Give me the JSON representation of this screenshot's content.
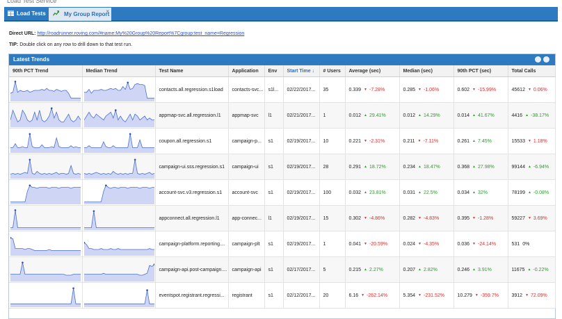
{
  "tabs": [
    {
      "label": "Load Tests"
    },
    {
      "label": "My Group Report",
      "close": "×"
    }
  ],
  "direct_url": {
    "label": "Direct URL:",
    "url": "http://roadrunner.roving.com/#name:My%20Group%20Report%7Cgroup:test_name=Regression"
  },
  "tip": {
    "label": "TIP:",
    "text": "Double click on any row to drill down to that test run."
  },
  "panel": {
    "title": "Latest Trends",
    "icons": [
      "print-icon",
      "refresh-icon"
    ]
  },
  "columns": [
    "90th PCT Trend",
    "Median Trend",
    "Test Name",
    "Application",
    "Env",
    "Start Time ↓",
    "# Users",
    "Average (sec)",
    "Median (sec)",
    "90th PCT (sec)",
    "Total Calls"
  ],
  "rows": [
    {
      "test": "contacts.all.regression.s1load",
      "app": "contacts-svc...",
      "env": "s1l...",
      "start": "02/22/2017...",
      "users": "35",
      "avg": "0.339",
      "avg_pct": "-7.28%",
      "avg_dir": "neg",
      "med": "0.285",
      "med_pct": "-1.06%",
      "med_dir": "neg",
      "p90": "0.602",
      "p90_pct": "-15.99%",
      "p90_dir": "neg",
      "calls": "45612",
      "calls_pct": "0.06%",
      "calls_dir": "neg",
      "spark1": [
        0.35,
        0.4,
        0.95,
        0.4,
        0.5,
        0.45,
        0.45,
        0.5,
        0.4,
        0.45,
        0.5,
        0.5,
        0.5,
        0.55,
        0.5,
        0.6,
        0.5,
        0.5,
        0.45,
        0.55,
        0.5,
        0.45,
        0.5,
        0.5,
        0.35,
        0.1,
        0.1,
        0.1,
        0.1,
        0.1
      ],
      "spark2": [
        0.4,
        0.4,
        0.55,
        0.35,
        0.5,
        0.5,
        0.5,
        0.55,
        0.5,
        0.5,
        0.55,
        0.6,
        0.55,
        0.6,
        0.5,
        0.5,
        0.7,
        0.55,
        0.9,
        0.55,
        0.6,
        0.8,
        0.85,
        0.8,
        0.8,
        0.75,
        0.1,
        0.1,
        0.1,
        0.1
      ]
    },
    {
      "test": "appmap-svc.all.regression.l1",
      "app": "appmap-svc",
      "env": "l1",
      "start": "02/21/2017...",
      "users": "1",
      "avg": "0.012",
      "avg_pct": "29.41%",
      "avg_dir": "pos",
      "med": "0.012",
      "med_pct": "14.29%",
      "med_dir": "pos",
      "p90": "0.014",
      "p90_pct": "41.67%",
      "p90_dir": "pos",
      "calls": "4416",
      "calls_pct": "-38.17%",
      "calls_dir": "pos",
      "spark1": [
        0.3,
        0.8,
        0.5,
        0.2,
        0.3,
        0.8,
        0.6,
        0.3,
        0.2,
        0.3,
        0.7,
        0.3,
        0.8,
        0.3,
        0.2,
        0.3,
        0.5,
        0.9,
        0.4,
        0.7,
        0.3,
        0.2,
        0.2,
        0.4,
        0.6,
        0.3,
        0.2,
        0.3,
        0.5,
        0.3
      ],
      "spark2": [
        0.3,
        0.5,
        0.7,
        0.5,
        0.4,
        0.6,
        0.5,
        0.4,
        0.3,
        0.5,
        0.6,
        0.7,
        0.4,
        0.8,
        0.3,
        0.5,
        0.3,
        0.2,
        0.4,
        0.6,
        0.3,
        0.6,
        0.5,
        0.3,
        0.4,
        0.5,
        0.3,
        0.4,
        0.3,
        0.3
      ]
    },
    {
      "test": "coupon.all.regression.s1",
      "app": "campaign-p...",
      "env": "s1",
      "start": "02/19/2017...",
      "users": "10",
      "avg": "0.221",
      "avg_pct": "-2.31%",
      "avg_dir": "neg",
      "med": "0.211",
      "med_pct": "-7.11%",
      "med_dir": "neg",
      "p90": "0.261",
      "p90_pct": "7.45%",
      "p90_dir": "pos",
      "calls": "15533",
      "calls_pct": "1.18%",
      "calls_dir": "neg",
      "spark1": [
        0.2,
        0.2,
        0.4,
        0.2,
        0.2,
        0.25,
        0.2,
        0.2,
        0.9,
        0.25,
        0.2,
        0.2,
        0.2,
        0.35,
        0.2,
        0.2,
        0.2,
        0.25,
        0.2,
        0.7,
        0.25,
        0.2,
        0.2,
        0.2,
        0.2,
        0.3,
        0.2,
        0.25,
        0.2,
        0.2
      ],
      "spark2": [
        0.2,
        0.2,
        0.3,
        0.2,
        0.2,
        0.2,
        0.2,
        0.2,
        0.5,
        0.25,
        0.2,
        0.2,
        0.3,
        0.2,
        0.2,
        0.2,
        0.2,
        0.2,
        0.2,
        0.9,
        0.2,
        0.2,
        0.2,
        0.6,
        0.2,
        0.2,
        0.2,
        0.2,
        0.2,
        0.2
      ]
    },
    {
      "test": "campaign-ui.sss.regression.s1",
      "app": "campaign-ui",
      "env": "s1",
      "start": "02/19/2017...",
      "users": "28",
      "avg": "0.291",
      "avg_pct": "18.72%",
      "avg_dir": "pos",
      "med": "0.234",
      "med_pct": "18.47%",
      "med_dir": "pos",
      "p90": "0.368",
      "p90_pct": "27.98%",
      "p90_dir": "pos",
      "calls": "99144",
      "calls_pct": "-6.94%",
      "calls_dir": "pos",
      "spark1": [
        0.15,
        0.2,
        0.15,
        0.2,
        0.15,
        0.2,
        0.25,
        0.2,
        0.9,
        0.2,
        0.15,
        0.3,
        0.2,
        0.15,
        0.2,
        0.15,
        0.2,
        0.15,
        0.2,
        0.25,
        0.15,
        0.2,
        0.2,
        0.15,
        0.2,
        0.6,
        0.2,
        0.15,
        0.2,
        0.15
      ],
      "spark2": [
        0.2,
        0.15,
        0.2,
        0.15,
        0.2,
        0.25,
        0.2,
        0.15,
        0.2,
        0.15,
        0.2,
        0.15,
        0.3,
        0.2,
        0.15,
        0.2,
        0.15,
        0.2,
        0.15,
        0.2,
        0.2,
        0.9,
        0.2,
        0.15,
        0.2,
        0.15,
        0.2,
        0.25,
        0.15,
        0.2
      ]
    },
    {
      "test": "account-svc.v3.regression.s1",
      "app": "account-svc",
      "env": "s1",
      "start": "02/19/2017...",
      "users": "100",
      "avg": "0.032",
      "avg_pct": "23.81%",
      "avg_dir": "pos",
      "med": "0.031",
      "med_pct": "22.5%",
      "med_dir": "pos",
      "p90": "0.034",
      "p90_pct": "32%",
      "p90_dir": "pos",
      "calls": "78199",
      "calls_pct": "-0.08%",
      "calls_dir": "pos",
      "spark1": [
        0.05,
        0.05,
        0.05,
        0.05,
        0.05,
        0.05,
        0.05,
        0.6,
        0.9,
        0.8,
        0.8,
        0.75,
        0.8,
        0.8,
        0.8,
        0.8,
        0.75,
        0.8,
        0.8,
        0.8,
        0.75,
        0.8,
        0.8,
        0.8,
        0.8,
        0.75,
        0.8,
        0.8,
        0.8,
        0.8
      ],
      "spark2": [
        0.05,
        0.05,
        0.05,
        0.05,
        0.05,
        0.05,
        0.05,
        0.05,
        0.6,
        0.9,
        0.8,
        0.75,
        0.8,
        0.8,
        0.75,
        0.8,
        0.8,
        0.8,
        0.75,
        0.8,
        0.8,
        0.8,
        0.8,
        0.75,
        0.8,
        0.8,
        0.8,
        0.75,
        0.8,
        0.8
      ]
    },
    {
      "test": "appconnect.all.regression.l1",
      "app": "app-connec...",
      "env": "l1",
      "start": "02/19/2017...",
      "users": "15",
      "avg": "0.302",
      "avg_pct": "-4.86%",
      "avg_dir": "neg",
      "med": "0.282",
      "med_pct": "-4.83%",
      "med_dir": "neg",
      "p90": "0.395",
      "p90_pct": "-1.28%",
      "p90_dir": "neg",
      "calls": "59227",
      "calls_pct": "3.69%",
      "calls_dir": "neg",
      "spark1": [
        0.05,
        0.05,
        0.95,
        0.05,
        0.05,
        0.05,
        0.05,
        0.05,
        0.05,
        0.05,
        0.05,
        0.05,
        0.05,
        0.05,
        0.05,
        0.05,
        0.05,
        0.05,
        0.05,
        0.05,
        0.05,
        0.05,
        0.05,
        0.05,
        0.05,
        0.05,
        0.05,
        0.05,
        0.05,
        0.05
      ],
      "spark2": [
        0.05,
        0.05,
        0.05,
        0.05,
        0.9,
        0.05,
        0.05,
        0.05,
        0.05,
        0.05,
        0.05,
        0.05,
        0.05,
        0.05,
        0.05,
        0.05,
        0.05,
        0.05,
        0.05,
        0.05,
        0.05,
        0.05,
        0.05,
        0.05,
        0.05,
        0.05,
        0.05,
        0.05,
        0.05,
        0.05
      ]
    },
    {
      "test": "campaign-platform.reporting....",
      "app": "campaign-plt",
      "env": "s1",
      "start": "02/19/2017...",
      "users": "1",
      "avg": "0.041",
      "avg_pct": "-20.59%",
      "avg_dir": "neg",
      "med": "0.024",
      "med_pct": "-4.35%",
      "med_dir": "neg",
      "p90": "0.036",
      "p90_pct": "-24.14%",
      "p90_dir": "neg",
      "calls": "531",
      "calls_pct": "0%",
      "calls_dir": "neu",
      "spark1": [
        0.85,
        0.8,
        0.3,
        0.3,
        0.3,
        0.3,
        0.25,
        0.3,
        0.3,
        0.25,
        0.2,
        0.2,
        0.2,
        0.2,
        0.2,
        0.2,
        0.25,
        0.2,
        0.2,
        0.2,
        0.2,
        0.2,
        0.2,
        0.2,
        0.2,
        0.2,
        0.2,
        0.2,
        0.2,
        0.2
      ],
      "spark2": [
        0.6,
        0.5,
        0.3,
        0.3,
        0.25,
        0.25,
        0.25,
        0.3,
        0.25,
        0.25,
        0.25,
        0.3,
        0.25,
        0.25,
        0.3,
        0.25,
        0.25,
        0.25,
        0.25,
        0.25,
        0.25,
        0.25,
        0.25,
        0.25,
        0.25,
        0.25,
        0.25,
        0.3,
        0.25,
        0.25
      ]
    },
    {
      "test": "campaign-api.post-campaign....",
      "app": "campaign-api",
      "env": "s1",
      "start": "02/17/2017...",
      "users": "5",
      "avg": "0.215",
      "avg_pct": "2.27%",
      "avg_dir": "pos",
      "med": "0.207",
      "med_pct": "2.82%",
      "med_dir": "pos",
      "p90": "0.246",
      "p90_pct": "3.91%",
      "p90_dir": "pos",
      "calls": "11675",
      "calls_pct": "-0.22%",
      "calls_dir": "pos",
      "spark1": [
        0.3,
        0.3,
        0.3,
        0.3,
        0.3,
        0.9,
        0.3,
        0.3,
        0.3,
        0.3,
        0.3,
        0.3,
        0.3,
        0.3,
        0.3,
        0.3,
        0.3,
        0.3,
        0.3,
        0.3,
        0.3,
        0.3,
        0.3,
        0.25,
        0.25,
        0.25,
        0.3,
        0.3,
        0.3,
        0.3
      ],
      "spark2": [
        0.3,
        0.3,
        0.3,
        0.3,
        0.3,
        0.3,
        0.3,
        0.3,
        0.35,
        0.3,
        0.3,
        0.3,
        0.3,
        0.3,
        0.3,
        0.3,
        0.3,
        0.3,
        0.3,
        0.3,
        0.3,
        0.3,
        0.3,
        0.25,
        0.25,
        0.3,
        0.35,
        0.75,
        0.7,
        0.8
      ]
    },
    {
      "test": "eventspot.registrant.regressi...",
      "app": "registrant",
      "env": "s1",
      "start": "02/12/2017...",
      "users": "20",
      "avg": "6.16",
      "avg_pct": "-262.14%",
      "avg_dir": "neg",
      "med": "5.354",
      "med_pct": "-231.52%",
      "med_dir": "neg",
      "p90": "10.279",
      "p90_pct": "-359.7%",
      "p90_dir": "neg",
      "calls": "3912",
      "calls_pct": "72.09%",
      "calls_dir": "neg",
      "spark1": [
        0.1,
        0.1,
        0.1,
        0.1,
        0.1,
        0.1,
        0.1,
        0.1,
        0.1,
        0.1,
        0.1,
        0.1,
        0.1,
        0.1,
        0.1,
        0.1,
        0.1,
        0.1,
        0.1,
        0.1,
        0.1,
        0.1,
        0.1,
        0.1,
        0.1,
        0.1,
        0.9,
        0.1,
        0.1,
        0.1
      ],
      "spark2": [
        0.1,
        0.1,
        0.1,
        0.1,
        0.1,
        0.1,
        0.1,
        0.1,
        0.1,
        0.1,
        0.1,
        0.1,
        0.1,
        0.1,
        0.1,
        0.1,
        0.1,
        0.1,
        0.1,
        0.1,
        0.1,
        0.1,
        0.1,
        0.1,
        0.1,
        0.1,
        0.8,
        0.1,
        0.1,
        0.1
      ]
    }
  ],
  "colors": {
    "header_blue": "#2d7ac0",
    "positive": "#2a9d2a",
    "negative": "#d33030",
    "spark_line": "#4a6fd0",
    "spark_fill": "#cfd6f5"
  }
}
